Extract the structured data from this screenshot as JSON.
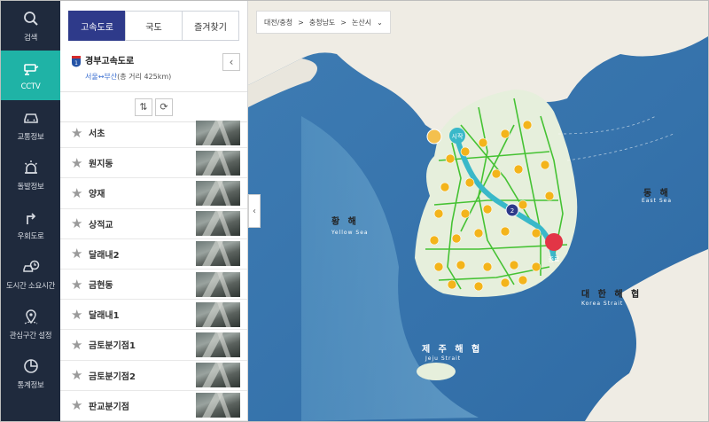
{
  "nav": {
    "items": [
      {
        "label": "검색",
        "icon": "search-icon"
      },
      {
        "label": "CCTV",
        "icon": "cctv-icon",
        "active": true
      },
      {
        "label": "교통정보",
        "icon": "car-icon"
      },
      {
        "label": "돌발정보",
        "icon": "alert-icon"
      },
      {
        "label": "우회도로",
        "icon": "detour-icon"
      },
      {
        "label": "도시간 소요시간",
        "icon": "travel-time-icon"
      },
      {
        "label": "관심구간 설정",
        "icon": "favorite-section-icon"
      },
      {
        "label": "통계정보",
        "icon": "statistics-icon"
      }
    ]
  },
  "tabs": [
    {
      "label": "고속도로",
      "active": true
    },
    {
      "label": "국도",
      "active": false
    },
    {
      "label": "즐겨찾기",
      "active": false
    }
  ],
  "route": {
    "number": "1",
    "name": "경부고속도로",
    "from_to": "서울↔부산",
    "length": "(총 거리 425km)"
  },
  "cctv_list": [
    {
      "name": "서초"
    },
    {
      "name": "원지동"
    },
    {
      "name": "양재"
    },
    {
      "name": "상적교"
    },
    {
      "name": "달래내2"
    },
    {
      "name": "금현동"
    },
    {
      "name": "달래내1"
    },
    {
      "name": "금토분기점1"
    },
    {
      "name": "금토분기점2"
    },
    {
      "name": "판교분기점"
    }
  ],
  "map": {
    "breadcrumb": [
      "대전/충청",
      "충청남도",
      "논산시"
    ],
    "seas": {
      "yellow_ko": "황 해",
      "yellow_en": "Yellow Sea",
      "east_ko": "동 해",
      "east_en": "East Sea",
      "strait_ko": "대 한 해 협",
      "strait_en": "Korea Strait",
      "jeju_ko": "제 주 해 협",
      "jeju_en": "Jeju Strait"
    },
    "markers": {
      "start": "시작",
      "end": "종료",
      "mid": "2"
    },
    "colors": {
      "route": "#39b8c9",
      "roads": "#45c233",
      "cctv": "#f3b41b",
      "sea": "#3f7fb4",
      "land": "#f1efe8"
    }
  }
}
